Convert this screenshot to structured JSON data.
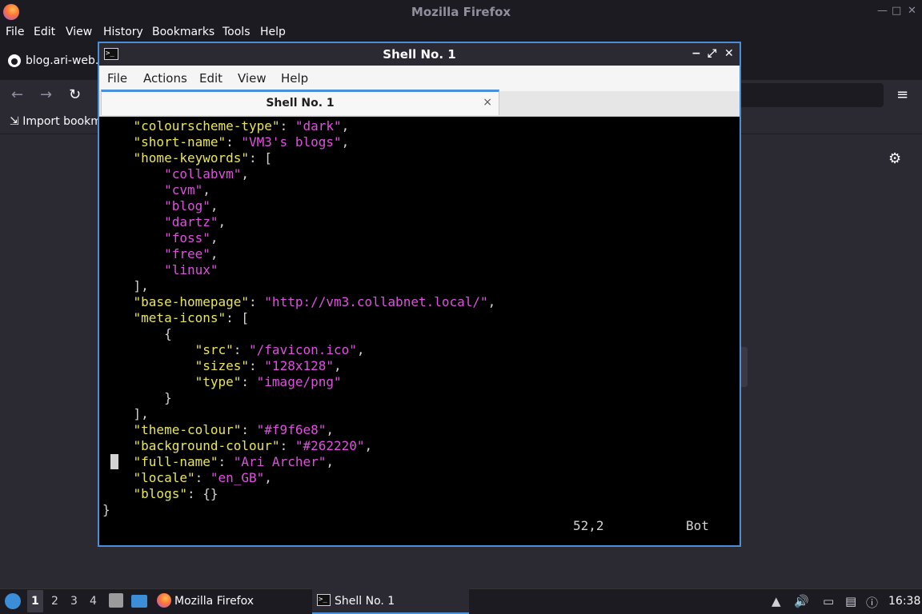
{
  "firefox": {
    "window_title": "Mozilla Firefox",
    "menu": [
      "File",
      "Edit",
      "View",
      "History",
      "Bookmarks",
      "Tools",
      "Help"
    ],
    "tab_title": "blog.ari-web.x",
    "bookmark": "Import bookm",
    "icons": {
      "back": "←",
      "forward": "→",
      "reload": "↻",
      "menu": "≡",
      "settings": "⚙",
      "minimize": "—",
      "restore": "□",
      "close": "✕"
    }
  },
  "shell": {
    "window_title": "Shell No. 1",
    "icon_glyph": ">_",
    "menu": [
      "File",
      "Actions",
      "Edit",
      "View",
      "Help"
    ],
    "tab_title": "Shell No. 1",
    "tab_close": "×",
    "controls": {
      "minimize": "−",
      "maximize": "⤢",
      "close": "✕"
    },
    "terminal_lines": [
      {
        "indent": "    ",
        "key": "\"colourscheme-type\"",
        "sep": ": ",
        "val": "\"dark\"",
        "tail": ","
      },
      {
        "indent": "    ",
        "key": "\"short-name\"",
        "sep": ": ",
        "val": "\"VM3's blogs\"",
        "tail": ","
      },
      {
        "indent": "    ",
        "key": "\"home-keywords\"",
        "sep": ": [",
        "val": "",
        "tail": ""
      },
      {
        "indent": "        ",
        "key": "",
        "sep": "",
        "val": "\"collabvm\"",
        "tail": ","
      },
      {
        "indent": "        ",
        "key": "",
        "sep": "",
        "val": "\"cvm\"",
        "tail": ","
      },
      {
        "indent": "        ",
        "key": "",
        "sep": "",
        "val": "\"blog\"",
        "tail": ","
      },
      {
        "indent": "        ",
        "key": "",
        "sep": "",
        "val": "\"dartz\"",
        "tail": ","
      },
      {
        "indent": "        ",
        "key": "",
        "sep": "",
        "val": "\"foss\"",
        "tail": ","
      },
      {
        "indent": "        ",
        "key": "",
        "sep": "",
        "val": "\"free\"",
        "tail": ","
      },
      {
        "indent": "        ",
        "key": "",
        "sep": "",
        "val": "\"linux\"",
        "tail": ""
      },
      {
        "indent": "    ",
        "key": "",
        "sep": "],",
        "val": "",
        "tail": ""
      },
      {
        "indent": "    ",
        "key": "\"base-homepage\"",
        "sep": ": ",
        "val": "\"http://vm3.collabnet.local/\"",
        "tail": ","
      },
      {
        "indent": "    ",
        "key": "\"meta-icons\"",
        "sep": ": [",
        "val": "",
        "tail": ""
      },
      {
        "indent": "        ",
        "key": "",
        "sep": "{",
        "val": "",
        "tail": ""
      },
      {
        "indent": "            ",
        "key": "\"src\"",
        "sep": ": ",
        "val": "\"/favicon.ico\"",
        "tail": ","
      },
      {
        "indent": "            ",
        "key": "\"sizes\"",
        "sep": ": ",
        "val": "\"128x128\"",
        "tail": ","
      },
      {
        "indent": "            ",
        "key": "\"type\"",
        "sep": ": ",
        "val": "\"image/png\"",
        "tail": ""
      },
      {
        "indent": "        ",
        "key": "",
        "sep": "}",
        "val": "",
        "tail": ""
      },
      {
        "indent": "    ",
        "key": "",
        "sep": "],",
        "val": "",
        "tail": ""
      },
      {
        "indent": "    ",
        "key": "\"theme-colour\"",
        "sep": ": ",
        "val": "\"#f9f6e8\"",
        "tail": ","
      },
      {
        "indent": "    ",
        "key": "\"background-colour\"",
        "sep": ": ",
        "val": "\"#262220\"",
        "tail": ","
      },
      {
        "indent": "    ",
        "key": "\"full-name\"",
        "sep": ": ",
        "val": "\"Ari Archer\"",
        "tail": ","
      },
      {
        "indent": "    ",
        "key": "\"locale\"",
        "sep": ": ",
        "val": "\"en_GB\"",
        "tail": ","
      },
      {
        "indent": "    ",
        "key": "\"blogs\"",
        "sep": ": {}",
        "val": "",
        "tail": ""
      },
      {
        "indent": "",
        "key": "",
        "sep": "}",
        "val": "",
        "tail": ""
      }
    ],
    "status_position": "52,2",
    "status_scroll": "Bot",
    "colors": {
      "key": "#e9e55b",
      "string": "#e04fe0",
      "accent": "#4a90d9"
    }
  },
  "taskbar": {
    "workspaces": [
      "1",
      "2",
      "3",
      "4"
    ],
    "active_workspace": "1",
    "firefox_label": "Mozilla Firefox",
    "shell_label": "Shell No. 1",
    "clock": "16:38",
    "tray_icons": [
      "up-arrow-icon",
      "volume-icon",
      "network-icon",
      "clipboard-icon",
      "notification-icon"
    ]
  }
}
